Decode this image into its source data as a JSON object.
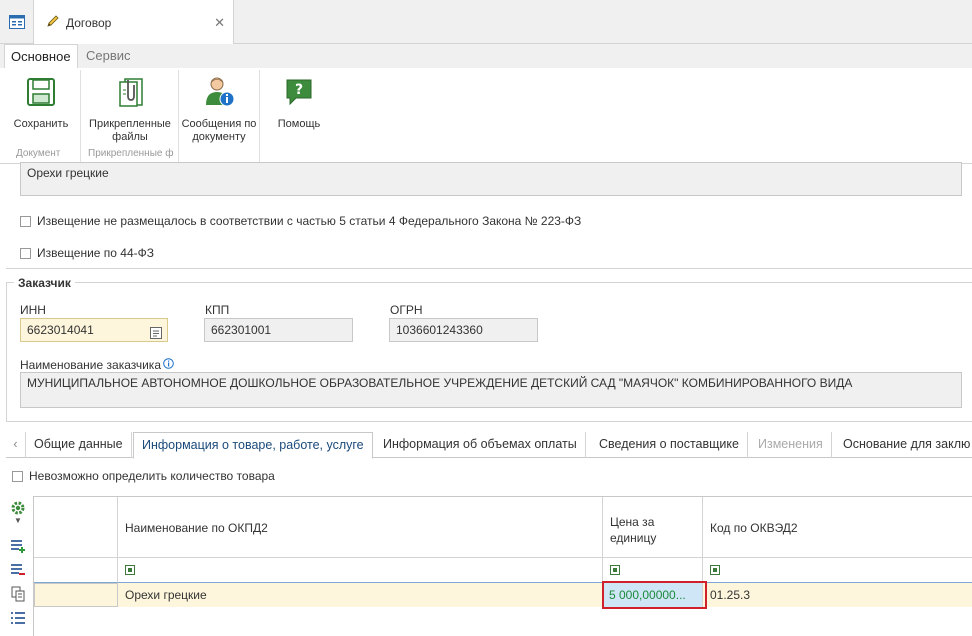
{
  "window": {
    "doc_tab_title": "Договор"
  },
  "ribbon": {
    "tabs": [
      "Основное",
      "Сервис"
    ],
    "buttons": {
      "save": "Сохранить",
      "attached_l1": "Прикрепленные",
      "attached_l2": "файлы",
      "messages_l1": "Сообщения по",
      "messages_l2": "документу",
      "help": "Помощь"
    },
    "groups": {
      "document": "Документ",
      "attached": "Прикрепленные ф"
    }
  },
  "form": {
    "subject_text": "Орехи грецкие",
    "check_notice_223": "Извещение не размещалось в соответствии с частью 5 статьи 4 Федерального Закона № 223-ФЗ",
    "check_notice_44": "Извещение по 44-ФЗ",
    "customer_section": "Заказчик",
    "inn_label": "ИНН",
    "inn_value": "6623014041",
    "kpp_label": "КПП",
    "kpp_value": "662301001",
    "ogrn_label": "ОГРН",
    "ogrn_value": "1036601243360",
    "customer_name_label": "Наименование заказчика",
    "customer_name_value": "МУНИЦИПАЛЬНОЕ АВТОНОМНОЕ ДОШКОЛЬНОЕ ОБРАЗОВАТЕЛЬНОЕ УЧРЕЖДЕНИЕ  ДЕТСКИЙ САД \"МАЯЧОК\" КОМБИНИРОВАННОГО ВИДА"
  },
  "tabs": [
    "Общие данные",
    "Информация о товаре, работе, услуге",
    "Информация об объемах оплаты",
    "Сведения о поставщике",
    "Изменения",
    "Основание для заклю"
  ],
  "goods": {
    "check_undetermined": "Невозможно определить количество товара",
    "columns": {
      "okpd2": "Наименование по ОКПД2",
      "price_l1": "Цена за",
      "price_l2": "единицу",
      "okved2": "Код по ОКВЭД2"
    },
    "rows": [
      {
        "okpd2": "Орехи грецкие",
        "price": "5 000,00000...",
        "okved2": "01.25.3"
      }
    ]
  },
  "colors": {
    "accent": "#1a4a7a",
    "required_bg": "#fdf6dc",
    "selected_cell_bg": "#cfe6f7",
    "highlight_border": "#d0202a",
    "price_text": "#1b8a3a"
  }
}
